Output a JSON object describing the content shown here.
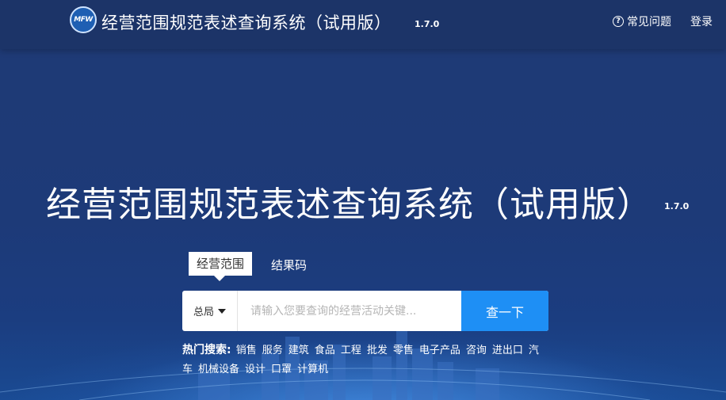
{
  "header": {
    "logo_text": "MFW",
    "title": "经营范围规范表述查询系统（试用版）",
    "version": "1.7.0",
    "faq_label": "常见问题",
    "faq_icon": "question-circle-icon",
    "login_label": "登录"
  },
  "hero": {
    "title": "经营范围规范表述查询系统（试用版）",
    "version": "1.7.0"
  },
  "tabs": [
    {
      "label": "经营范围",
      "active": true
    },
    {
      "label": "结果码",
      "active": false
    }
  ],
  "search": {
    "scope_value": "总局",
    "placeholder": "请输入您要查询的经营活动关键...",
    "value": "",
    "button_label": "查一下"
  },
  "hot_searches": {
    "label": "热门搜索:",
    "items": [
      "销售",
      "服务",
      "建筑",
      "食品",
      "工程",
      "批发",
      "零售",
      "电子产品",
      "咨询",
      "进出口",
      "汽车",
      "机械设备",
      "设计",
      "口罩",
      "计算机"
    ]
  },
  "colors": {
    "background": "#1d3a78",
    "header": "#1c3468",
    "accent": "#1e8ff5"
  }
}
